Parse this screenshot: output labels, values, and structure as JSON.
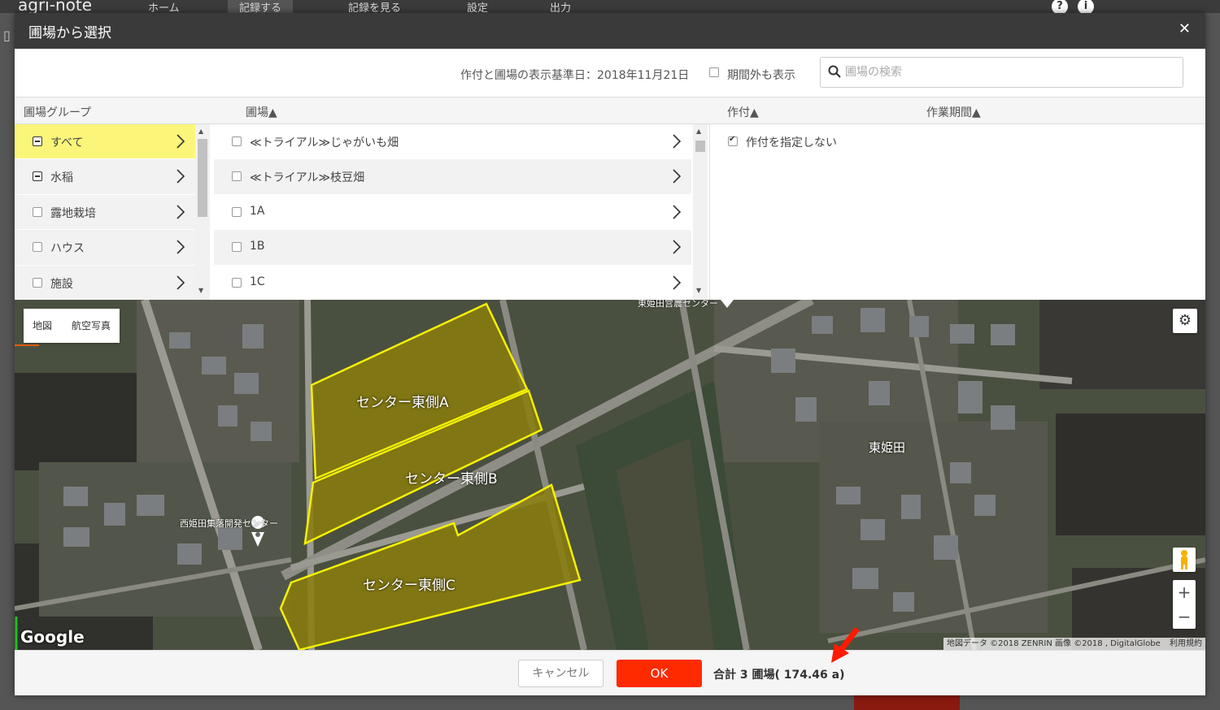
{
  "app": {
    "logo": "agri-note",
    "nav": [
      {
        "label": "ホーム",
        "icon": "home-icon"
      },
      {
        "label": "記録する",
        "icon": "pencil-icon",
        "active": true
      },
      {
        "label": "記録を見る",
        "icon": "book-icon"
      },
      {
        "label": "設定",
        "icon": "gear-icon"
      },
      {
        "label": "出力",
        "icon": "file-icon"
      }
    ]
  },
  "modal": {
    "title": "圃場から選択",
    "close_icon": "close-icon",
    "date_label": "作付と圃場の表示基準日：2018年11月21日",
    "show_out_of_period": {
      "label": "期間外も表示",
      "checked": false
    },
    "search": {
      "placeholder": "圃場の検索",
      "value": ""
    }
  },
  "columns": {
    "group": "圃場グループ",
    "field": "圃場▲",
    "crop": "作付▲",
    "period": "作業期間▲"
  },
  "groups": [
    {
      "label": "すべて",
      "state": "indeterminate",
      "selected": true
    },
    {
      "label": "水稲",
      "state": "indeterminate",
      "selected": false
    },
    {
      "label": "露地栽培",
      "state": "unchecked",
      "selected": false
    },
    {
      "label": "ハウス",
      "state": "unchecked",
      "selected": false
    },
    {
      "label": "施設",
      "state": "unchecked",
      "selected": false
    }
  ],
  "fields": [
    {
      "label": "≪トライアル≫じゃがいも畑",
      "checked": false
    },
    {
      "label": "≪トライアル≫枝豆畑",
      "checked": false
    },
    {
      "label": "1A",
      "checked": false
    },
    {
      "label": "1B",
      "checked": false
    },
    {
      "label": "1C",
      "checked": false
    }
  ],
  "crops": [
    {
      "label": "作付を指定しない",
      "checked": true
    }
  ],
  "map": {
    "type_buttons": [
      "地図",
      "航空写真"
    ],
    "field_labels": [
      "センター東側A",
      "センター東側B",
      "センター東側C"
    ],
    "place_labels": {
      "district": "東姫田",
      "center": "西姫田集落開発センター",
      "top": "東姫田営農センター"
    },
    "google": "Google",
    "attribution": "地図データ ©2018 ZENRIN 画像 ©2018 , DigitalGlobe",
    "terms": "利用規約",
    "zoom_in": "+",
    "zoom_out": "−",
    "field_color": "#f5f000"
  },
  "footer": {
    "cancel": "キャンセル",
    "ok": "OK",
    "total": "合計 3 圃場( 174.46 a)",
    "ok_color": "#ff2a00"
  }
}
